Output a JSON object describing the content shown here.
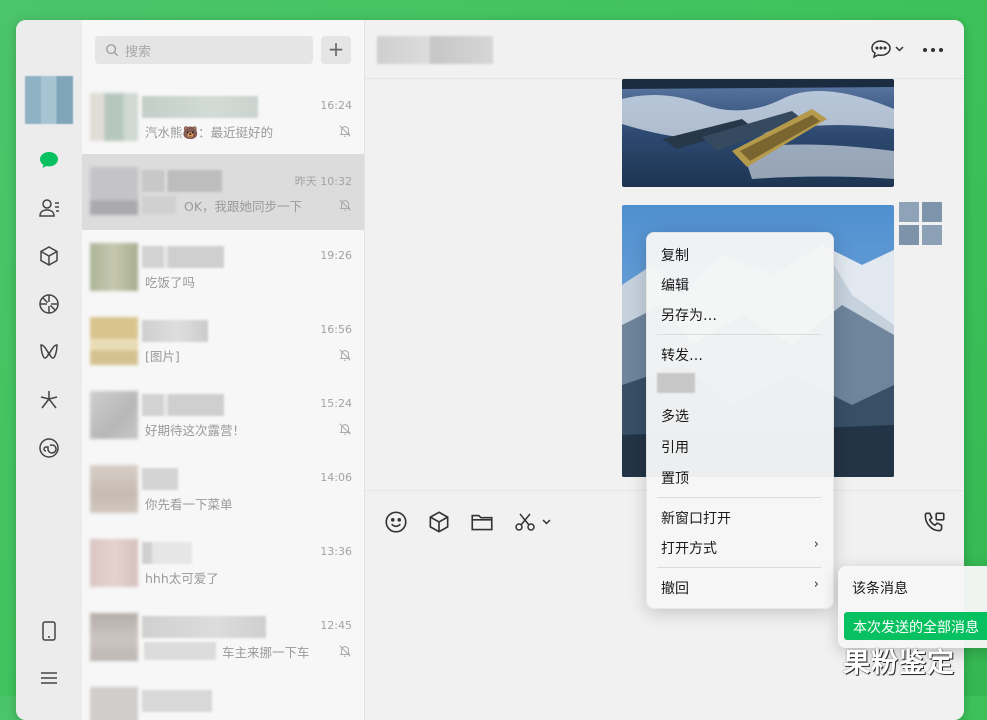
{
  "search": {
    "placeholder": "搜索"
  },
  "add_label": "+",
  "conversations": [
    {
      "time": "16:24",
      "message": "汽水熊🐻：最近挺好的",
      "muted": true
    },
    {
      "time": "昨天 10:32",
      "message": "OK，我跟她同步一下",
      "muted": true
    },
    {
      "time": "19:26",
      "message": "吃饭了吗",
      "muted": false
    },
    {
      "time": "16:56",
      "message": "[图片]",
      "muted": true
    },
    {
      "time": "15:24",
      "message": "好期待这次露营！",
      "muted": true
    },
    {
      "time": "14:06",
      "message": "你先看一下菜单",
      "muted": false
    },
    {
      "time": "13:36",
      "message": "hhh太可爱了",
      "muted": false
    },
    {
      "time": "12:45",
      "message": "车主来挪一下车",
      "muted": true
    }
  ],
  "context_menu": {
    "copy": "复制",
    "edit": "编辑",
    "save_as": "另存为…",
    "forward": "转发…",
    "multi_select": "多选",
    "quote": "引用",
    "pin": "置顶",
    "open_new_window": "新窗口打开",
    "open_with": "打开方式",
    "recall": "撤回"
  },
  "recall_submenu": {
    "this_message": "该条消息",
    "all_sent": "本次发送的全部消息"
  },
  "chevron": "›",
  "watermark": "果粉鉴定",
  "colors": {
    "accent": "#07c160",
    "background": "#3ec35c"
  }
}
